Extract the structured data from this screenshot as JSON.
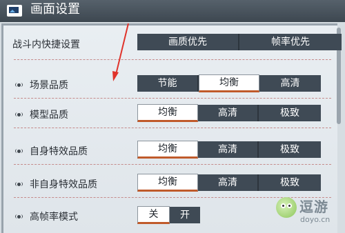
{
  "window": {
    "title": "画面设置",
    "title_icon": "picture-icon"
  },
  "quick": {
    "label": "战斗内快捷设置",
    "options": [
      "画质优先",
      "帧率优先"
    ],
    "selected": null
  },
  "settings": [
    {
      "label": "场景品质",
      "options": [
        "节能",
        "均衡",
        "高清"
      ],
      "selected": "均衡"
    },
    {
      "label": "模型品质",
      "options": [
        "均衡",
        "高清",
        "极致"
      ],
      "selected": "均衡"
    },
    {
      "label": "自身特效品质",
      "options": [
        "均衡",
        "高清",
        "极致"
      ],
      "selected": "均衡"
    },
    {
      "label": "非自身特效品质",
      "options": [
        "均衡",
        "高清",
        "极致"
      ],
      "selected": "均衡"
    },
    {
      "label": "高帧率模式",
      "options": [
        "关",
        "开"
      ],
      "selected": "关"
    }
  ],
  "annotation": {
    "arrow_color": "#e0332b"
  },
  "watermark": {
    "name": "逗游",
    "url": "doyo.cn"
  },
  "colors": {
    "selected_underline": "#c05a2a",
    "option_bg": "#3f4a55"
  }
}
